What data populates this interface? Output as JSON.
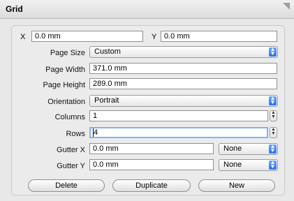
{
  "window": {
    "title": "Grid"
  },
  "position": {
    "x_label": "X",
    "x_value": "0.0 mm",
    "y_label": "Y",
    "y_value": "0.0 mm"
  },
  "form": {
    "page_size_label": "Page Size",
    "page_size_value": "Custom",
    "page_width_label": "Page Width",
    "page_width_value": "371.0 mm",
    "page_height_label": "Page Height",
    "page_height_value": "289.0 mm",
    "orientation_label": "Orientation",
    "orientation_value": "Portrait",
    "columns_label": "Columns",
    "columns_value": "1",
    "rows_label": "Rows",
    "rows_value": "4",
    "gutter_x_label": "Gutter X",
    "gutter_x_value": "0.0 mm",
    "gutter_x_mode": "None",
    "gutter_y_label": "Gutter Y",
    "gutter_y_value": "0.0 mm",
    "gutter_y_mode": "None"
  },
  "buttons": {
    "delete": "Delete",
    "duplicate": "Duplicate",
    "new": "New"
  }
}
